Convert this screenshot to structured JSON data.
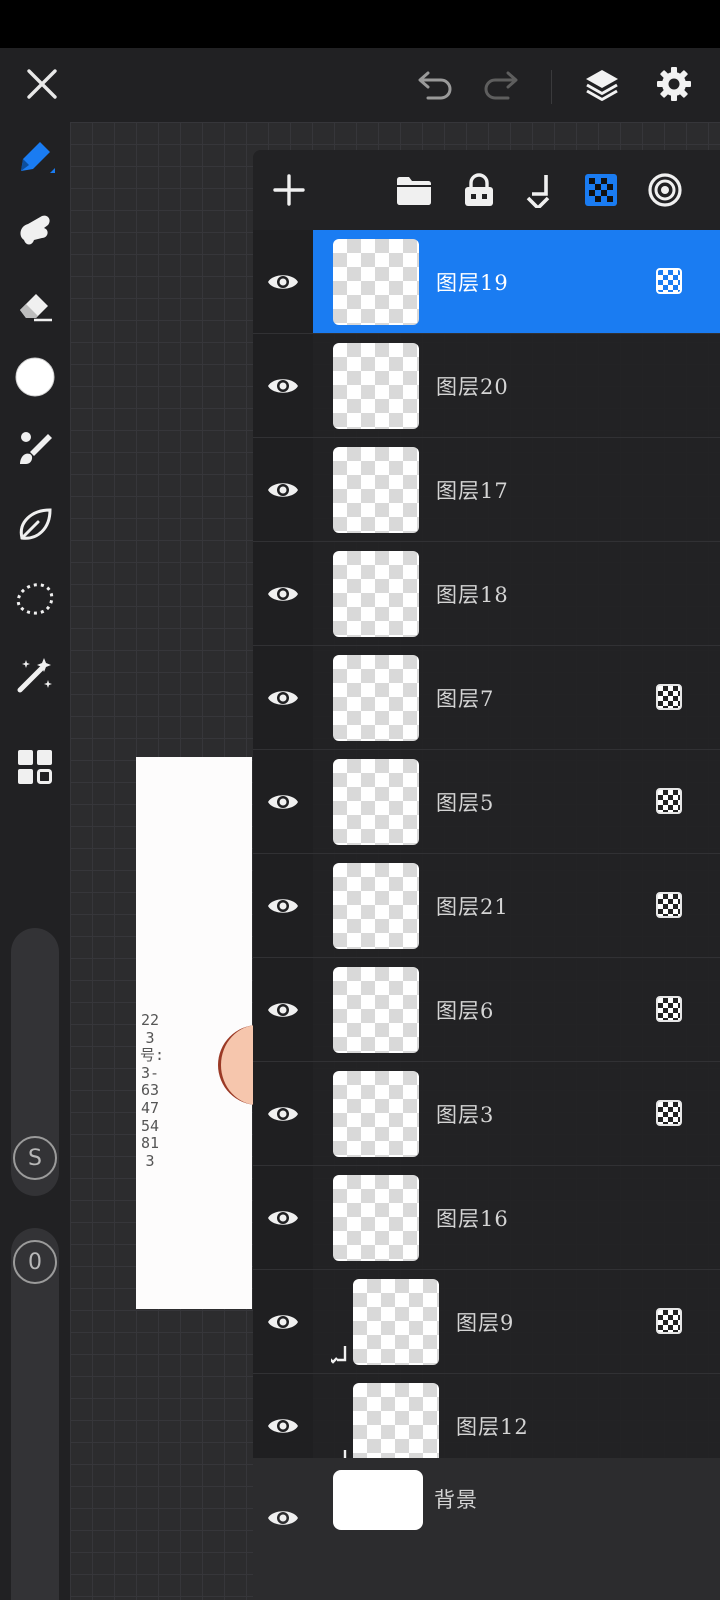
{
  "topbar": {
    "close_icon": "close-icon",
    "undo_icon": "undo-icon",
    "redo_icon": "redo-icon",
    "layers_icon": "layers-icon",
    "settings_icon": "gear-icon"
  },
  "tools": [
    {
      "name": "pen-tool",
      "icon": "pen-icon"
    },
    {
      "name": "smudge-tool",
      "icon": "smudge-icon"
    },
    {
      "name": "eraser-tool",
      "icon": "eraser-icon"
    },
    {
      "name": "color-tool",
      "icon": "color-circle-icon"
    },
    {
      "name": "brush-library-tool",
      "icon": "brush-icon"
    },
    {
      "name": "blend-tool",
      "icon": "leaf-icon"
    },
    {
      "name": "lasso-tool",
      "icon": "lasso-icon"
    },
    {
      "name": "magic-tool",
      "icon": "magic-wand-icon"
    },
    {
      "name": "more-tool",
      "icon": "grid-icon"
    }
  ],
  "sliders": {
    "size_label": "S",
    "opacity_label": "0"
  },
  "canvas": {
    "paper_text": "223号:3-634754813"
  },
  "panel_toolbar": {
    "add_icon": "plus-icon",
    "folder_icon": "folder-icon",
    "lock_icon": "lock-icon",
    "merge_down_icon": "merge-down-icon",
    "alpha_icon": "checker-icon",
    "blend_icon": "spiral-icon"
  },
  "layers": [
    {
      "name": "图层19",
      "selected": true,
      "alpha_locked": true,
      "clipped": false
    },
    {
      "name": "图层20",
      "selected": false,
      "alpha_locked": false,
      "clipped": false
    },
    {
      "name": "图层17",
      "selected": false,
      "alpha_locked": false,
      "clipped": false
    },
    {
      "name": "图层18",
      "selected": false,
      "alpha_locked": false,
      "clipped": false
    },
    {
      "name": "图层7",
      "selected": false,
      "alpha_locked": true,
      "clipped": false
    },
    {
      "name": "图层5",
      "selected": false,
      "alpha_locked": true,
      "clipped": false
    },
    {
      "name": "图层21",
      "selected": false,
      "alpha_locked": true,
      "clipped": false
    },
    {
      "name": "图层6",
      "selected": false,
      "alpha_locked": true,
      "clipped": false
    },
    {
      "name": "图层3",
      "selected": false,
      "alpha_locked": true,
      "clipped": false
    },
    {
      "name": "图层16",
      "selected": false,
      "alpha_locked": false,
      "clipped": false
    },
    {
      "name": "图层9",
      "selected": false,
      "alpha_locked": true,
      "clipped": true
    },
    {
      "name": "图层12",
      "selected": false,
      "alpha_locked": false,
      "clipped": true
    }
  ],
  "background_layer": {
    "name": "背景"
  },
  "colors": {
    "accent": "#1a7cf2",
    "panel": "#222224",
    "toolbar": "#212123"
  }
}
